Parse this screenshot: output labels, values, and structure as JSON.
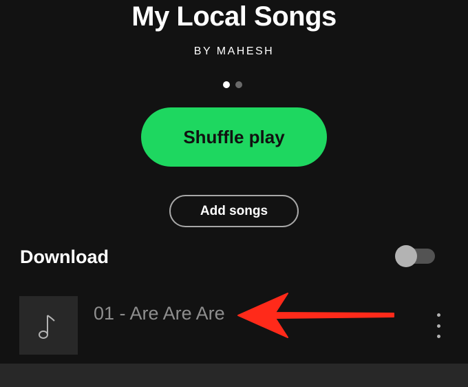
{
  "playlist": {
    "title": "My Local Songs",
    "byline": "BY MAHESH"
  },
  "pager": {
    "total_pages": 2,
    "active_page": 1
  },
  "actions": {
    "shuffle_label": "Shuffle play",
    "add_songs_label": "Add songs"
  },
  "download": {
    "label": "Download",
    "enabled": false
  },
  "tracks": [
    {
      "title": "01 - Are Are Are",
      "artwork_icon": "music-note-icon"
    }
  ],
  "annotation": {
    "arrow_icon": "red-arrow-icon",
    "arrow_color": "#ff2a1a"
  },
  "colors": {
    "background": "#121212",
    "accent": "#1ed760",
    "track_title": "#8e8e8e"
  }
}
